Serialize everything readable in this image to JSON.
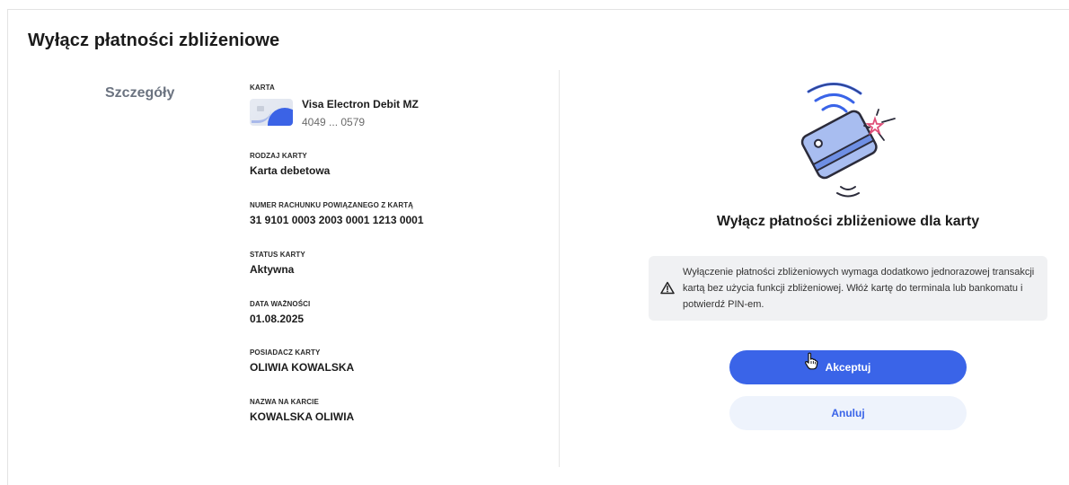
{
  "page": {
    "title": "Wyłącz płatności zbliżeniowe"
  },
  "details": {
    "section_label": "Szczegóły",
    "card": {
      "label": "KARTA",
      "name": "Visa Electron Debit MZ",
      "number": "4049 ... 0579"
    },
    "fields": [
      {
        "label": "RODZAJ KARTY",
        "value": "Karta debetowa"
      },
      {
        "label": "NUMER RACHUNKU POWIĄZANEGO Z KARTĄ",
        "value": "31 9101 0003 2003 0001 1213 0001"
      },
      {
        "label": "STATUS KARTY",
        "value": "Aktywna"
      },
      {
        "label": "DATA WAŻNOŚCI",
        "value": "01.08.2025"
      },
      {
        "label": "POSIADACZ KARTY",
        "value": "OLIWIA KOWALSKA"
      },
      {
        "label": "NAZWA NA KARCIE",
        "value": "KOWALSKA OLIWIA"
      }
    ]
  },
  "confirm": {
    "heading": "Wyłącz płatności zbliżeniowe dla karty",
    "info": "Wyłączenie płatności zbliżeniowych wymaga dodatkowo jednorazowej transakcji kartą bez użycia funkcji zbliżeniowej. Włóż kartę do terminala lub bankomatu i potwierdź PIN-em.",
    "accept_label": "Akceptuj",
    "cancel_label": "Anuluj"
  },
  "icons": {
    "illustration": "contactless-card-illustration",
    "warning": "warning-icon",
    "cursor": "hand-pointer-icon"
  },
  "colors": {
    "accent": "#3a64e8",
    "cancel_bg": "#eef3fc",
    "info_bg": "#f0f1f3",
    "section_label": "#6b7380"
  }
}
